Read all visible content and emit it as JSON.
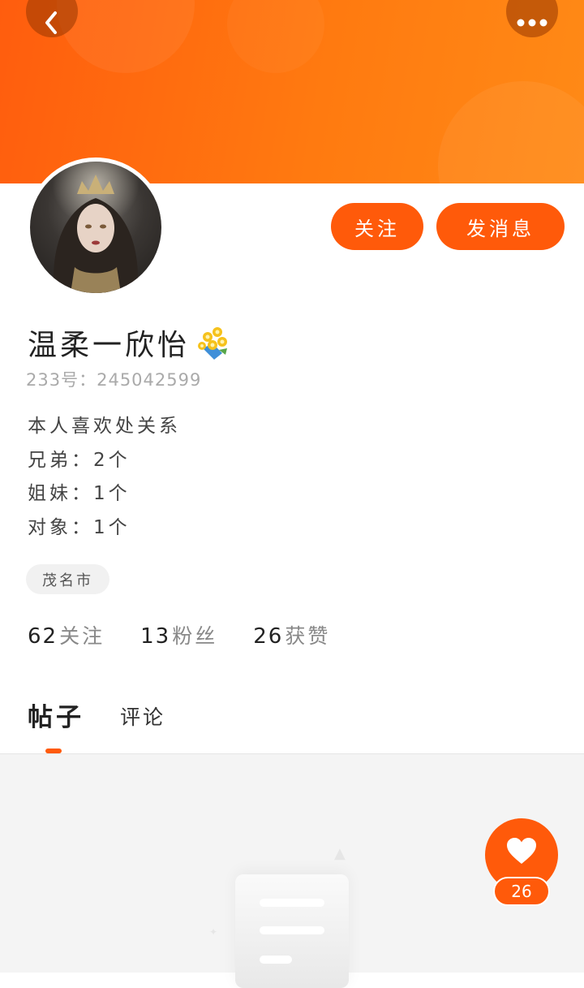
{
  "colors": {
    "accent": "#ff5a0a",
    "banner_start": "#ff5d0e",
    "banner_end": "#ff8a16",
    "muted": "#aaaaaa"
  },
  "header": {
    "back_icon": "chevron-left-icon",
    "more_icon": "more-dots-icon"
  },
  "profile": {
    "nickname": "温柔一欣怡",
    "nickname_emoji": "bouquet-icon",
    "uid_label": "233号：",
    "uid_value": "245042599",
    "bio_lines": [
      "本人喜欢处关系",
      "兄弟：2个",
      "姐妹：1个",
      "对象：1个"
    ],
    "location": "茂名市"
  },
  "actions": {
    "follow_label": "关注",
    "message_label": "发消息"
  },
  "stats": [
    {
      "value": "62",
      "label": "关注"
    },
    {
      "value": "13",
      "label": "粉丝"
    },
    {
      "value": "26",
      "label": "获赞"
    }
  ],
  "tabs": [
    {
      "label": "帖子",
      "active": true
    },
    {
      "label": "评论",
      "active": false
    }
  ],
  "like_button": {
    "icon": "heart-icon",
    "count": "26"
  }
}
